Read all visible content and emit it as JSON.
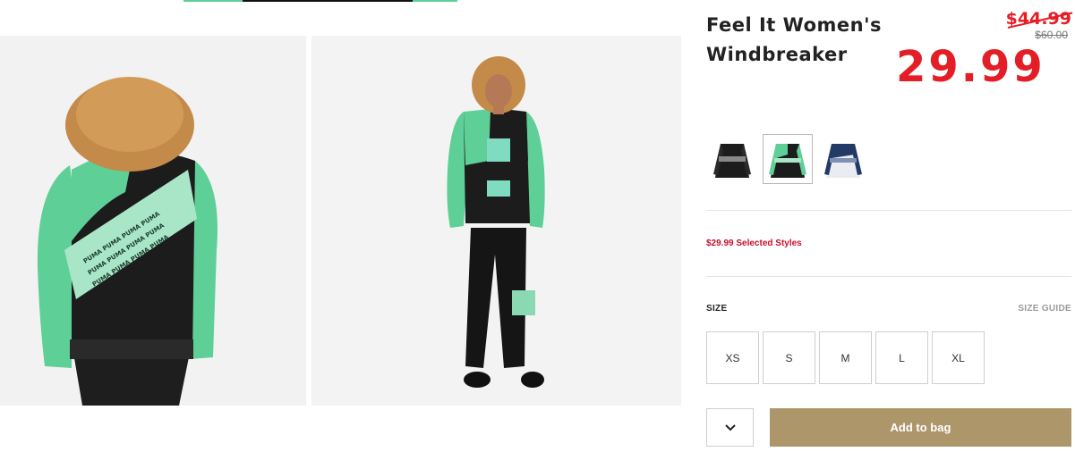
{
  "product": {
    "title": "Feel It Women's Windbreaker",
    "old_price": "$44.99",
    "original_price": "$60.00",
    "sale_price": "29.99",
    "promo": "$29.99 Selected Styles"
  },
  "swatches": [
    {
      "name": "black",
      "selected": false
    },
    {
      "name": "green-black",
      "selected": true
    },
    {
      "name": "navy-white",
      "selected": false
    }
  ],
  "size": {
    "label": "SIZE",
    "guide": "SIZE GUIDE",
    "options": [
      "XS",
      "S",
      "M",
      "L",
      "XL"
    ]
  },
  "actions": {
    "add_to_bag": "Add to bag"
  },
  "colors": {
    "accent": "#ae966b",
    "sale_red": "#e41e26",
    "jacket_green": "#5fcf98",
    "jacket_black": "#1c1c1c"
  }
}
